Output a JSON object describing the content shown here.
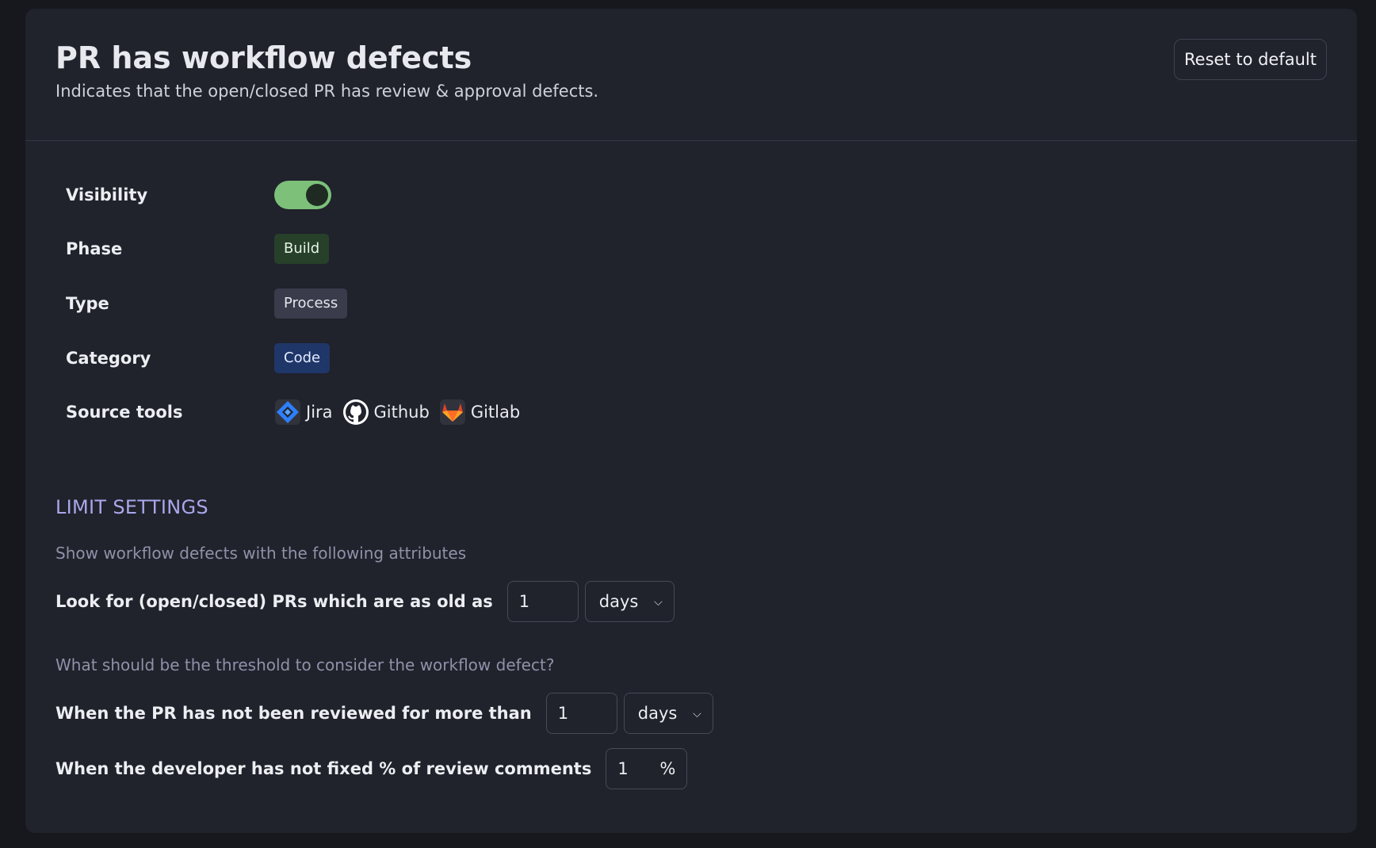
{
  "header": {
    "title": "PR has workflow defects",
    "subtitle": "Indicates that the open/closed PR has review & approval defects.",
    "reset_label": "Reset to default"
  },
  "details": {
    "visibility_label": "Visibility",
    "visibility_on": true,
    "phase_label": "Phase",
    "phase_value": "Build",
    "type_label": "Type",
    "type_value": "Process",
    "category_label": "Category",
    "category_value": "Code",
    "source_tools_label": "Source tools",
    "tools": [
      {
        "name": "Jira",
        "icon": "jira-icon"
      },
      {
        "name": "Github",
        "icon": "github-icon"
      },
      {
        "name": "Gitlab",
        "icon": "gitlab-icon"
      }
    ]
  },
  "limits": {
    "section_title": "LIMIT SETTINGS",
    "hint1": "Show workflow defects with the following attributes",
    "age_label": "Look for (open/closed) PRs which are as old as",
    "age_value": "1",
    "age_unit": "days",
    "hint2": "What should be the threshold to consider the workflow defect?",
    "review_label": "When the PR has not been reviewed for more than",
    "review_value": "1",
    "review_unit": "days",
    "fix_label": "When the developer has not fixed % of review comments",
    "fix_value": "1",
    "fix_unit": "%"
  },
  "colors": {
    "toggle_on": "#7cc07a",
    "section_accent": "#a9a8ea",
    "build_chip": "#26402a",
    "process_chip": "#3a3b4b",
    "code_chip": "#1f3668"
  }
}
